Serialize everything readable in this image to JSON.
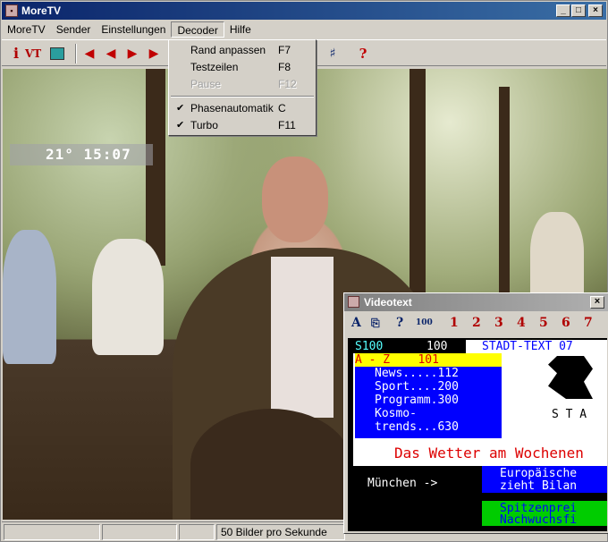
{
  "window": {
    "title": "MoreTV",
    "app_icon": "tv-icon",
    "controls": {
      "minimize": "_",
      "maximize": "□",
      "close": "×"
    }
  },
  "menubar": {
    "items": [
      "MoreTV",
      "Sender",
      "Einstellungen",
      "Decoder",
      "Hilfe"
    ]
  },
  "toolbar": {
    "info": "i",
    "vt": "VT",
    "arrows": [
      "◀",
      "◀",
      "▶",
      "▶"
    ],
    "help": "?"
  },
  "decoder_menu": {
    "items": [
      {
        "label": "Rand anpassen",
        "shortcut": "F7",
        "checked": false,
        "enabled": true
      },
      {
        "label": "Testzeilen",
        "shortcut": "F8",
        "checked": false,
        "enabled": true
      },
      {
        "label": "Pause",
        "shortcut": "F12",
        "checked": false,
        "enabled": false
      },
      {
        "label": "Phasenautomatik",
        "shortcut": "C",
        "checked": true,
        "enabled": true
      },
      {
        "label": "Turbo",
        "shortcut": "F11",
        "checked": true,
        "enabled": true
      }
    ]
  },
  "osd": {
    "text": "21° 15:07"
  },
  "videotext": {
    "title": "Videotext",
    "close": "×",
    "tools": {
      "font": "A",
      "copy": "⎘",
      "help": "?",
      "page": "100",
      "numbers": [
        "1",
        "2",
        "3",
        "4",
        "5",
        "6",
        "7"
      ]
    },
    "page": {
      "header_page": "S100",
      "header_num": "100",
      "header_title": "STADT-TEXT 07",
      "index": "A - Z    101",
      "rows": [
        "News.....112",
        "Sport....200",
        "Programm.300",
        "Kosmo-",
        "trends...630"
      ],
      "logo_text": "S T A",
      "headline": "Das Wetter am Wochenen",
      "city": "München ->",
      "europe": [
        "Europäische",
        "zieht Bilan"
      ],
      "spitzen": [
        "Spitzenprei",
        "Nachwuchsfi"
      ]
    }
  },
  "status": {
    "fps": "50 Bilder pro Sekunde"
  }
}
